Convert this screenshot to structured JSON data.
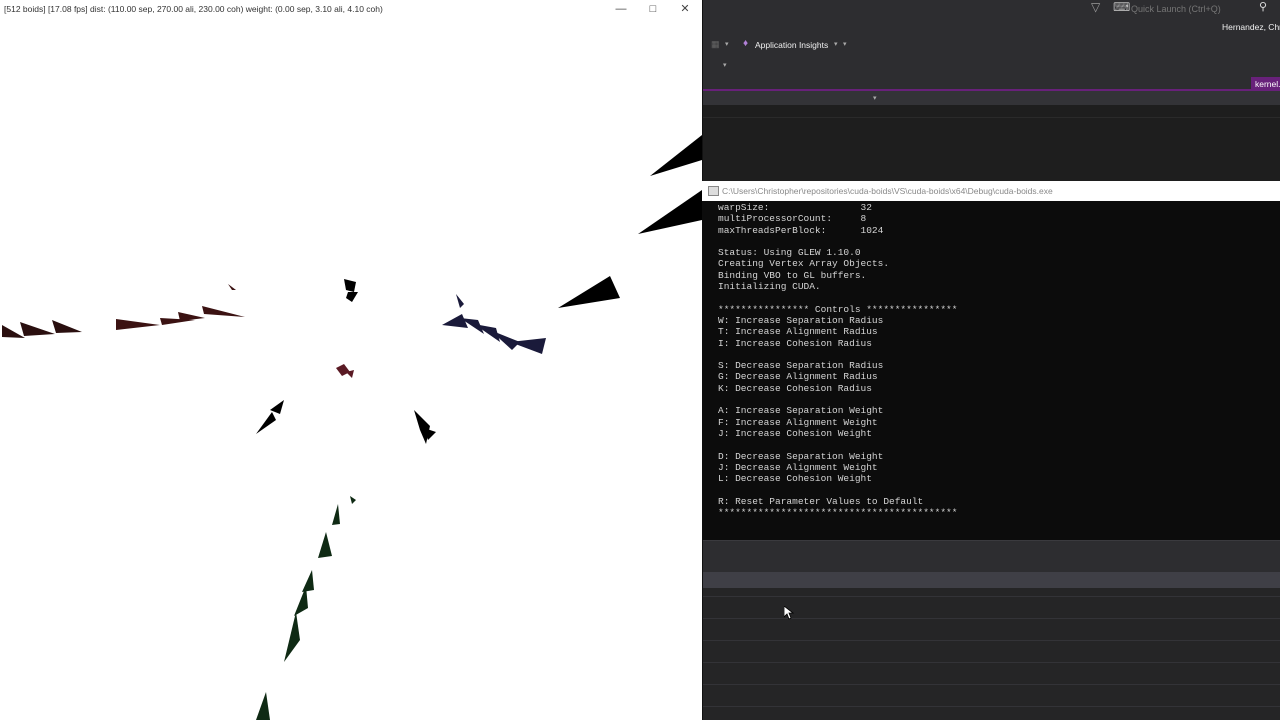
{
  "boids_window": {
    "title": "[512 boids] [17.08 fps] dist: (110.00 sep, 270.00 ali, 230.00 coh) weight: (0.00 sep, 3.10 ali, 4.10 coh)",
    "controls": {
      "minimize": "—",
      "maximize": "□",
      "close": "✕"
    },
    "background_color": "#ffffff",
    "flock_colors": [
      "#2a0f0f",
      "#3b1212",
      "#5a1a24",
      "#1a1a3a",
      "#000000",
      "#1f3320",
      "#0f2a14"
    ]
  },
  "ide": {
    "quick_launch_placeholder": "Quick Launch (Ctrl+Q)",
    "user_name": "Hernandez, Chr",
    "application_insights": "Application Insights",
    "active_tab": "kernel.h",
    "accent_color": "#68217a",
    "icons": [
      "filter-icon",
      "notification-icon",
      "search-icon",
      "lightbulb-icon",
      "chevron-down-icon"
    ]
  },
  "console": {
    "title": "C:\\Users\\Christopher\\repositories\\cuda-boids\\VS\\cuda-boids\\x64\\Debug\\cuda-boids.exe",
    "lines": [
      "warpSize:                32",
      "multiProcessorCount:     8",
      "maxThreadsPerBlock:      1024",
      "",
      "Status: Using GLEW 1.10.0",
      "Creating Vertex Array Objects.",
      "Binding VBO to GL buffers.",
      "Initializing CUDA.",
      "",
      "**************** Controls ****************",
      "W: Increase Separation Radius",
      "T: Increase Alignment Radius",
      "I: Increase Cohesion Radius",
      "",
      "S: Decrease Separation Radius",
      "G: Decrease Alignment Radius",
      "K: Decrease Cohesion Radius",
      "",
      "A: Increase Separation Weight",
      "F: Increase Alignment Weight",
      "J: Increase Cohesion Weight",
      "",
      "D: Decrease Separation Weight",
      "J: Decrease Alignment Weight",
      "L: Decrease Cohesion Weight",
      "",
      "R: Reset Parameter Values to Default",
      "******************************************"
    ]
  }
}
